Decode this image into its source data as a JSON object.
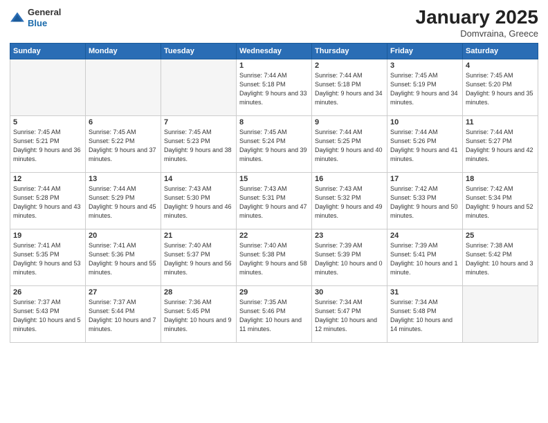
{
  "header": {
    "logo_line1": "General",
    "logo_line2": "Blue",
    "month_title": "January 2025",
    "subtitle": "Domvraina, Greece"
  },
  "days_of_week": [
    "Sunday",
    "Monday",
    "Tuesday",
    "Wednesday",
    "Thursday",
    "Friday",
    "Saturday"
  ],
  "weeks": [
    [
      {
        "num": "",
        "empty": true
      },
      {
        "num": "",
        "empty": true
      },
      {
        "num": "",
        "empty": true
      },
      {
        "num": "1",
        "sunrise": "7:44 AM",
        "sunset": "5:18 PM",
        "daylight": "9 hours and 33 minutes."
      },
      {
        "num": "2",
        "sunrise": "7:44 AM",
        "sunset": "5:18 PM",
        "daylight": "9 hours and 34 minutes."
      },
      {
        "num": "3",
        "sunrise": "7:45 AM",
        "sunset": "5:19 PM",
        "daylight": "9 hours and 34 minutes."
      },
      {
        "num": "4",
        "sunrise": "7:45 AM",
        "sunset": "5:20 PM",
        "daylight": "9 hours and 35 minutes."
      }
    ],
    [
      {
        "num": "5",
        "sunrise": "7:45 AM",
        "sunset": "5:21 PM",
        "daylight": "9 hours and 36 minutes."
      },
      {
        "num": "6",
        "sunrise": "7:45 AM",
        "sunset": "5:22 PM",
        "daylight": "9 hours and 37 minutes."
      },
      {
        "num": "7",
        "sunrise": "7:45 AM",
        "sunset": "5:23 PM",
        "daylight": "9 hours and 38 minutes."
      },
      {
        "num": "8",
        "sunrise": "7:45 AM",
        "sunset": "5:24 PM",
        "daylight": "9 hours and 39 minutes."
      },
      {
        "num": "9",
        "sunrise": "7:44 AM",
        "sunset": "5:25 PM",
        "daylight": "9 hours and 40 minutes."
      },
      {
        "num": "10",
        "sunrise": "7:44 AM",
        "sunset": "5:26 PM",
        "daylight": "9 hours and 41 minutes."
      },
      {
        "num": "11",
        "sunrise": "7:44 AM",
        "sunset": "5:27 PM",
        "daylight": "9 hours and 42 minutes."
      }
    ],
    [
      {
        "num": "12",
        "sunrise": "7:44 AM",
        "sunset": "5:28 PM",
        "daylight": "9 hours and 43 minutes."
      },
      {
        "num": "13",
        "sunrise": "7:44 AM",
        "sunset": "5:29 PM",
        "daylight": "9 hours and 45 minutes."
      },
      {
        "num": "14",
        "sunrise": "7:43 AM",
        "sunset": "5:30 PM",
        "daylight": "9 hours and 46 minutes."
      },
      {
        "num": "15",
        "sunrise": "7:43 AM",
        "sunset": "5:31 PM",
        "daylight": "9 hours and 47 minutes."
      },
      {
        "num": "16",
        "sunrise": "7:43 AM",
        "sunset": "5:32 PM",
        "daylight": "9 hours and 49 minutes."
      },
      {
        "num": "17",
        "sunrise": "7:42 AM",
        "sunset": "5:33 PM",
        "daylight": "9 hours and 50 minutes."
      },
      {
        "num": "18",
        "sunrise": "7:42 AM",
        "sunset": "5:34 PM",
        "daylight": "9 hours and 52 minutes."
      }
    ],
    [
      {
        "num": "19",
        "sunrise": "7:41 AM",
        "sunset": "5:35 PM",
        "daylight": "9 hours and 53 minutes."
      },
      {
        "num": "20",
        "sunrise": "7:41 AM",
        "sunset": "5:36 PM",
        "daylight": "9 hours and 55 minutes."
      },
      {
        "num": "21",
        "sunrise": "7:40 AM",
        "sunset": "5:37 PM",
        "daylight": "9 hours and 56 minutes."
      },
      {
        "num": "22",
        "sunrise": "7:40 AM",
        "sunset": "5:38 PM",
        "daylight": "9 hours and 58 minutes."
      },
      {
        "num": "23",
        "sunrise": "7:39 AM",
        "sunset": "5:39 PM",
        "daylight": "10 hours and 0 minutes."
      },
      {
        "num": "24",
        "sunrise": "7:39 AM",
        "sunset": "5:41 PM",
        "daylight": "10 hours and 1 minute."
      },
      {
        "num": "25",
        "sunrise": "7:38 AM",
        "sunset": "5:42 PM",
        "daylight": "10 hours and 3 minutes."
      }
    ],
    [
      {
        "num": "26",
        "sunrise": "7:37 AM",
        "sunset": "5:43 PM",
        "daylight": "10 hours and 5 minutes."
      },
      {
        "num": "27",
        "sunrise": "7:37 AM",
        "sunset": "5:44 PM",
        "daylight": "10 hours and 7 minutes."
      },
      {
        "num": "28",
        "sunrise": "7:36 AM",
        "sunset": "5:45 PM",
        "daylight": "10 hours and 9 minutes."
      },
      {
        "num": "29",
        "sunrise": "7:35 AM",
        "sunset": "5:46 PM",
        "daylight": "10 hours and 11 minutes."
      },
      {
        "num": "30",
        "sunrise": "7:34 AM",
        "sunset": "5:47 PM",
        "daylight": "10 hours and 12 minutes."
      },
      {
        "num": "31",
        "sunrise": "7:34 AM",
        "sunset": "5:48 PM",
        "daylight": "10 hours and 14 minutes."
      },
      {
        "num": "",
        "empty": true
      }
    ]
  ]
}
